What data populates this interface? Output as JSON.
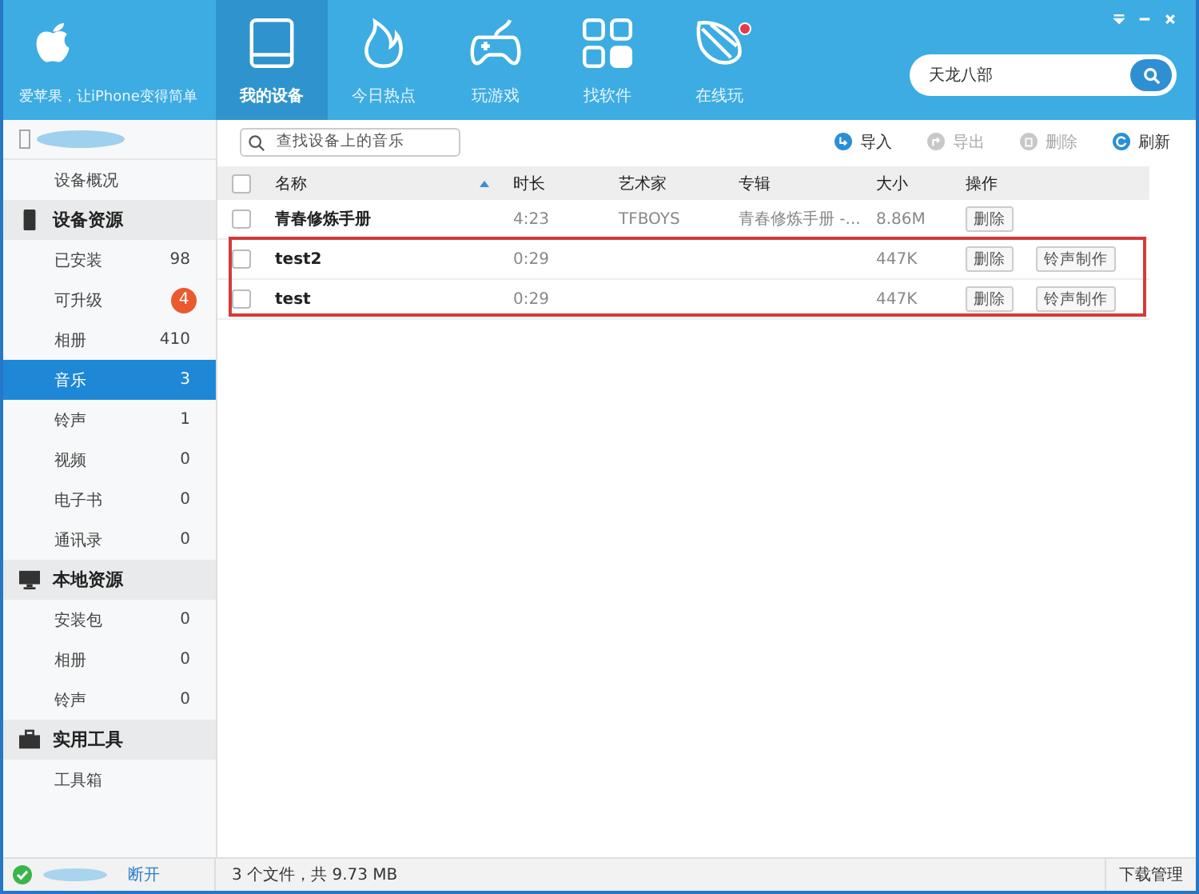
{
  "header": {
    "tagline": "爱苹果，让iPhone变得简单",
    "tabs": [
      {
        "label": "我的设备",
        "selected": true,
        "dot": false
      },
      {
        "label": "今日热点",
        "selected": false,
        "dot": false
      },
      {
        "label": "玩游戏",
        "selected": false,
        "dot": false
      },
      {
        "label": "找软件",
        "selected": false,
        "dot": false
      },
      {
        "label": "在线玩",
        "selected": false,
        "dot": true
      }
    ],
    "search": {
      "value": "天龙八部"
    }
  },
  "sidebar": {
    "entries": [
      {
        "kind": "link",
        "label": "设备概况",
        "selected": false
      },
      {
        "kind": "group",
        "label": "设备资源"
      },
      {
        "kind": "item",
        "label": "已安装",
        "count": "98",
        "badge": false,
        "selected": false
      },
      {
        "kind": "item",
        "label": "可升级",
        "count": "4",
        "badge": true,
        "selected": false
      },
      {
        "kind": "item",
        "label": "相册",
        "count": "410",
        "badge": false,
        "selected": false
      },
      {
        "kind": "item",
        "label": "音乐",
        "count": "3",
        "badge": false,
        "selected": true
      },
      {
        "kind": "item",
        "label": "铃声",
        "count": "1",
        "badge": false,
        "selected": false
      },
      {
        "kind": "item",
        "label": "视频",
        "count": "0",
        "badge": false,
        "selected": false
      },
      {
        "kind": "item",
        "label": "电子书",
        "count": "0",
        "badge": false,
        "selected": false
      },
      {
        "kind": "item",
        "label": "通讯录",
        "count": "0",
        "badge": false,
        "selected": false
      },
      {
        "kind": "group",
        "label": "本地资源"
      },
      {
        "kind": "item",
        "label": "安装包",
        "count": "0",
        "badge": false,
        "selected": false
      },
      {
        "kind": "item",
        "label": "相册",
        "count": "0",
        "badge": false,
        "selected": false
      },
      {
        "kind": "item",
        "label": "铃声",
        "count": "0",
        "badge": false,
        "selected": false
      },
      {
        "kind": "group",
        "label": "实用工具"
      },
      {
        "kind": "link",
        "label": "工具箱",
        "selected": false
      }
    ]
  },
  "search": {
    "placeholder": "查找设备上的音乐"
  },
  "toolbar": [
    {
      "label": "导入",
      "disabled": false
    },
    {
      "label": "导出",
      "disabled": true
    },
    {
      "label": "删除",
      "disabled": true
    },
    {
      "label": "刷新",
      "disabled": false
    }
  ],
  "table": {
    "all_checked": false,
    "columns": [
      "名称",
      "时长",
      "艺术家",
      "专辑",
      "大小",
      "操作"
    ],
    "rows": [
      {
        "checked": false,
        "highlighted": false,
        "cells": [
          "青春修炼手册",
          "4:23",
          "TFBOYS",
          "青春修炼手册 -...",
          "8.86M"
        ],
        "actions": [
          "删除"
        ]
      },
      {
        "checked": false,
        "highlighted": true,
        "cells": [
          "test2",
          "0:29",
          "",
          "",
          "447K"
        ],
        "actions": [
          "删除",
          "铃声制作"
        ]
      },
      {
        "checked": false,
        "highlighted": true,
        "cells": [
          "test",
          "0:29",
          "",
          "",
          "447K"
        ],
        "actions": [
          "删除",
          "铃声制作"
        ]
      }
    ]
  },
  "status_bar": {
    "connection": "断开",
    "summary": "3 个文件，共 9.73 MB",
    "downloads": "下载管理"
  }
}
